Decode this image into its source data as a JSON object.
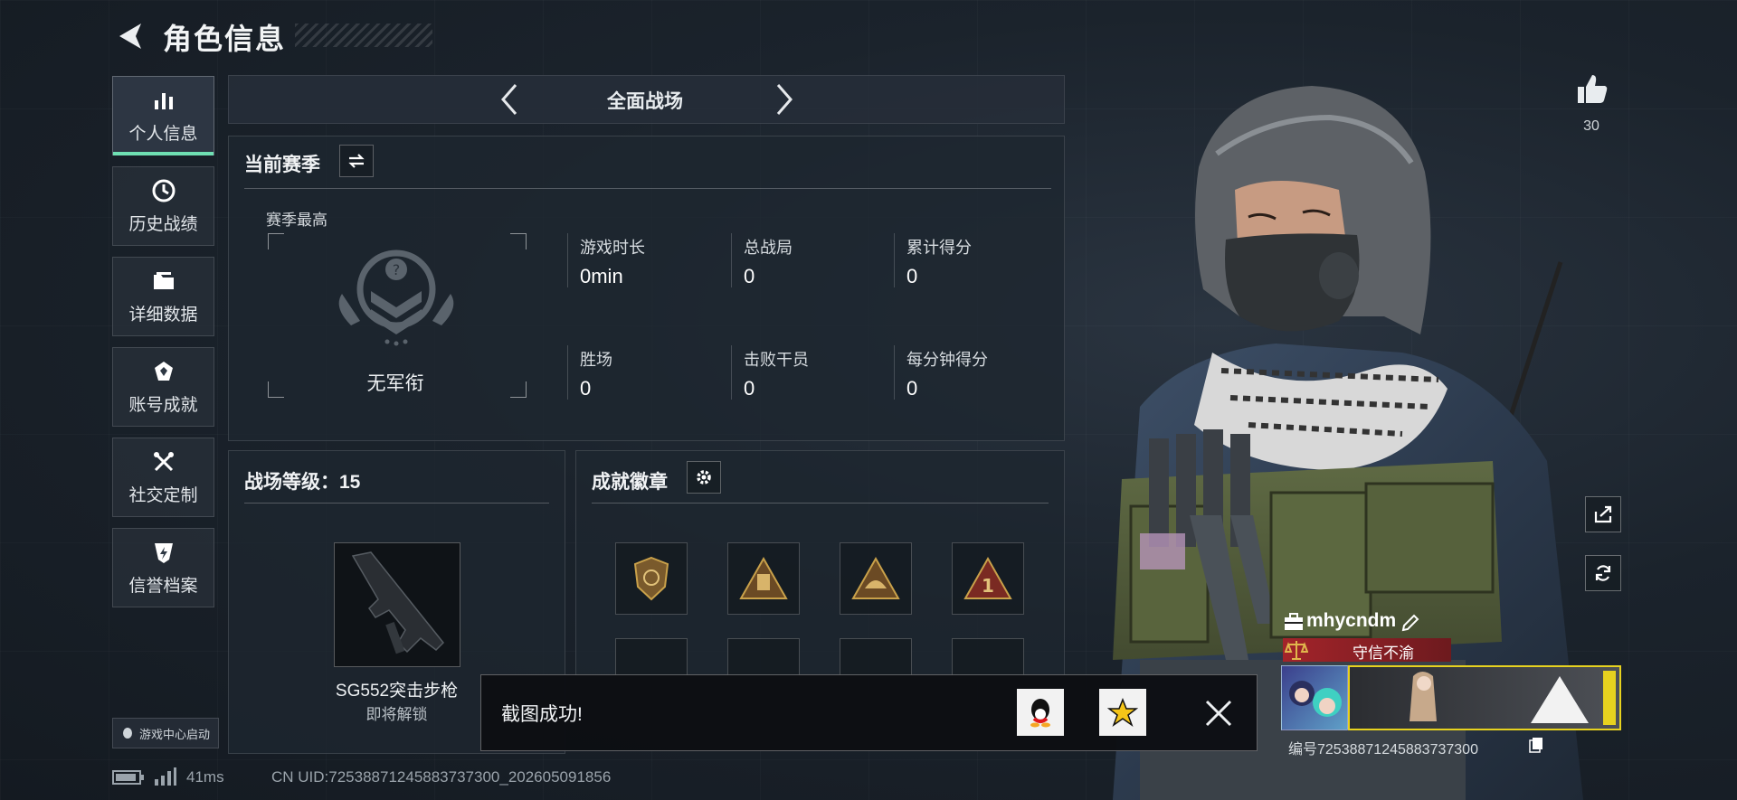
{
  "header": {
    "title": "角色信息"
  },
  "sidebar": {
    "items": [
      {
        "label": "个人信息",
        "icon": "bar-chart-icon",
        "active": true
      },
      {
        "label": "历史战绩",
        "icon": "clock-icon"
      },
      {
        "label": "详细数据",
        "icon": "folder-icon"
      },
      {
        "label": "账号成就",
        "icon": "achievement-icon"
      },
      {
        "label": "社交定制",
        "icon": "tools-icon"
      },
      {
        "label": "信誉档案",
        "icon": "shield-lightning-icon"
      }
    ],
    "game_center": "游戏中心启动"
  },
  "mode": {
    "title": "全面战场"
  },
  "season": {
    "title": "当前赛季",
    "best_label": "赛季最高",
    "rank_name": "无军衔",
    "stats": [
      {
        "label": "游戏时长",
        "value": "0min"
      },
      {
        "label": "总战局",
        "value": "0"
      },
      {
        "label": "累计得分",
        "value": "0"
      },
      {
        "label": "胜场",
        "value": "0"
      },
      {
        "label": "击败干员",
        "value": "0"
      },
      {
        "label": "每分钟得分",
        "value": "0"
      }
    ]
  },
  "level": {
    "title": "战场等级：15",
    "weapon_name": "SG552突击步枪",
    "weapon_status": "即将解锁"
  },
  "badges": {
    "title": "成就徽章"
  },
  "toast": {
    "text": "截图成功!"
  },
  "profile": {
    "likes": "30",
    "username": "mhycndm",
    "reputation": "守信不渝",
    "id_text": "编号7253887124588373​7300"
  },
  "footer": {
    "ping": "41ms",
    "uid": "CN UID:7253887124588373​7300_202605091856"
  },
  "colors": {
    "accent": "#6fe0b3",
    "gold": "#c9a14a",
    "rep_red": "#a3242a",
    "plate_yellow": "#e7d21f"
  }
}
